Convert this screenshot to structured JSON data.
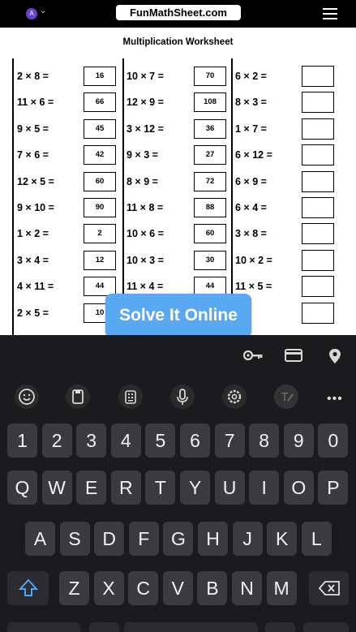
{
  "browser": {
    "avatar_letter": "A",
    "url": "FunMathSheet.com"
  },
  "worksheet": {
    "title": "Multiplication Worksheet",
    "columns": [
      [
        {
          "problem": "2 × 8 =",
          "answer": "16"
        },
        {
          "problem": "11 × 6 =",
          "answer": "66"
        },
        {
          "problem": "9 × 5 =",
          "answer": "45"
        },
        {
          "problem": "7 × 6 =",
          "answer": "42"
        },
        {
          "problem": "12 × 5 =",
          "answer": "60"
        },
        {
          "problem": "9 × 10 =",
          "answer": "90"
        },
        {
          "problem": "1 × 2 =",
          "answer": "2"
        },
        {
          "problem": "3 × 4 =",
          "answer": "12"
        },
        {
          "problem": "4 × 11 =",
          "answer": "44"
        },
        {
          "problem": "2 × 5 =",
          "answer": "10"
        }
      ],
      [
        {
          "problem": "10 × 7 =",
          "answer": "70"
        },
        {
          "problem": "12 × 9 =",
          "answer": "108"
        },
        {
          "problem": "3 × 12 =",
          "answer": "36"
        },
        {
          "problem": "9 × 3 =",
          "answer": "27"
        },
        {
          "problem": "8 × 9 =",
          "answer": "72"
        },
        {
          "problem": "11 × 8 =",
          "answer": "88"
        },
        {
          "problem": "10 × 6 =",
          "answer": "60"
        },
        {
          "problem": "10 × 3 =",
          "answer": "30"
        },
        {
          "problem": "11 × 4 =",
          "answer": "44"
        }
      ],
      [
        {
          "problem": "6 × 2 =",
          "answer": ""
        },
        {
          "problem": "8 × 3 =",
          "answer": ""
        },
        {
          "problem": "1 × 7 =",
          "answer": ""
        },
        {
          "problem": "6 × 12 =",
          "answer": ""
        },
        {
          "problem": "6 × 9 =",
          "answer": ""
        },
        {
          "problem": "6 × 4 =",
          "answer": ""
        },
        {
          "problem": "3 × 8 =",
          "answer": ""
        },
        {
          "problem": "10 × 2 =",
          "answer": ""
        },
        {
          "problem": "11 × 5 =",
          "answer": ""
        },
        {
          "problem": "4 =",
          "answer": ""
        }
      ]
    ]
  },
  "solve_button": {
    "label": "Solve It Online"
  },
  "keyboard": {
    "row_numbers": [
      "1",
      "2",
      "3",
      "4",
      "5",
      "6",
      "7",
      "8",
      "9",
      "0"
    ],
    "row_top": [
      "Q",
      "W",
      "E",
      "R",
      "T",
      "Y",
      "U",
      "I",
      "O",
      "P"
    ],
    "row_middle": [
      "A",
      "S",
      "D",
      "F",
      "G",
      "H",
      "J",
      "K",
      "L"
    ],
    "row_bottom": [
      "Z",
      "X",
      "C",
      "V",
      "B",
      "N",
      "M"
    ],
    "autofill_icons": [
      "key-icon",
      "card-icon",
      "location-icon"
    ],
    "toolbar_icons": [
      "emoji-icon",
      "clipboard-icon",
      "keypad-icon",
      "mic-icon",
      "settings-icon",
      "handwriting-icon",
      "more-icon"
    ]
  }
}
